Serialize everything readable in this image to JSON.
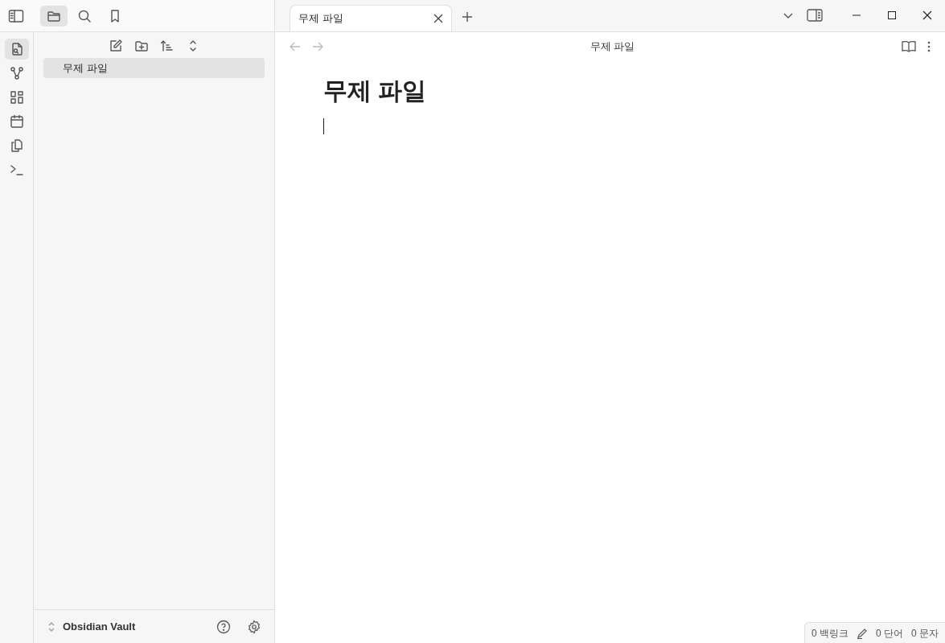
{
  "sidebar_tabs": [
    {
      "selected": true
    },
    {
      "selected": false
    },
    {
      "selected": false
    }
  ],
  "ribbon": [
    {
      "selected": true
    },
    {
      "selected": false
    },
    {
      "selected": false
    },
    {
      "selected": false
    },
    {
      "selected": false
    },
    {
      "selected": false
    }
  ],
  "file_tree": {
    "items": [
      {
        "label": "무제 파일",
        "selected": true
      }
    ]
  },
  "tabs": [
    {
      "label": "무제 파일",
      "selected": true
    }
  ],
  "view_header": {
    "title": "무제 파일"
  },
  "note": {
    "title": "무제 파일"
  },
  "vault": {
    "name": "Obsidian Vault"
  },
  "status_bar": {
    "backlinks": "0 백링크",
    "words": "0 단어",
    "characters": "0 문자"
  }
}
